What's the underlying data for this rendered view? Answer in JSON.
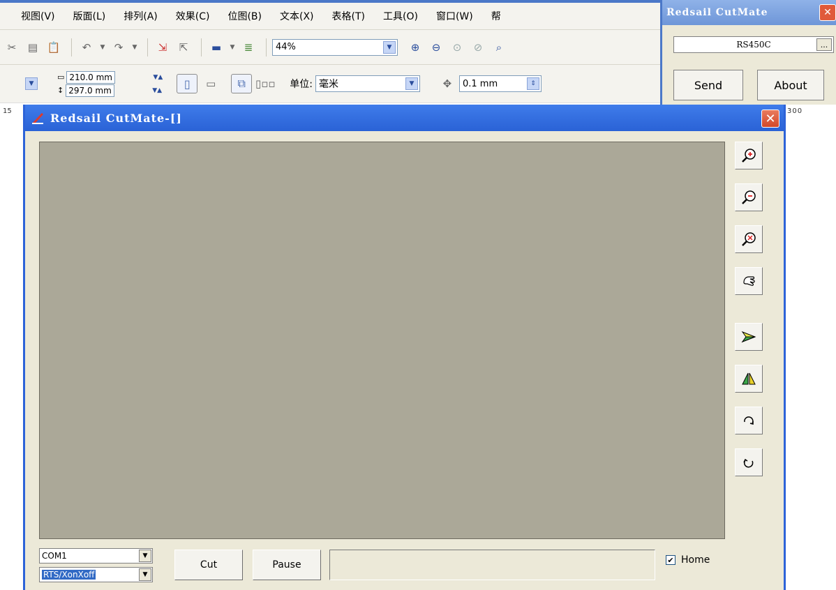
{
  "host": {
    "menu": [
      "视图(V)",
      "版面(L)",
      "排列(A)",
      "效果(C)",
      "位图(B)",
      "文本(X)",
      "表格(T)",
      "工具(O)",
      "窗口(W)",
      "帮"
    ],
    "zoom": "44%",
    "page_width": "210.0 mm",
    "page_height": "297.0 mm",
    "unit_label": "单位:",
    "unit_value": "毫米",
    "nudge": "0.1 mm",
    "ruler_left": "15",
    "ruler_right": "300"
  },
  "mini_panel": {
    "title": "Redsail CutMate",
    "model": "RS450C",
    "browse_label": "...",
    "send_label": "Send",
    "about_label": "About"
  },
  "dialog": {
    "title": "Redsail CutMate-[]",
    "port": "COM1",
    "handshake": "RTS/XonXoff",
    "cut_label": "Cut",
    "pause_label": "Pause",
    "status_text": "",
    "home_label": "Home",
    "home_checked": "✔"
  },
  "colors": {
    "canvas": "#aba898",
    "title_blue": "#2a62d6",
    "close_red": "#d2482a"
  },
  "icons": [
    "zoom-in-icon",
    "zoom-out-icon",
    "zoom-fit-icon",
    "pan-hand-icon",
    "arrow-right-icon",
    "mirror-icon",
    "rotate-cw-icon",
    "rotate-ccw-icon"
  ]
}
